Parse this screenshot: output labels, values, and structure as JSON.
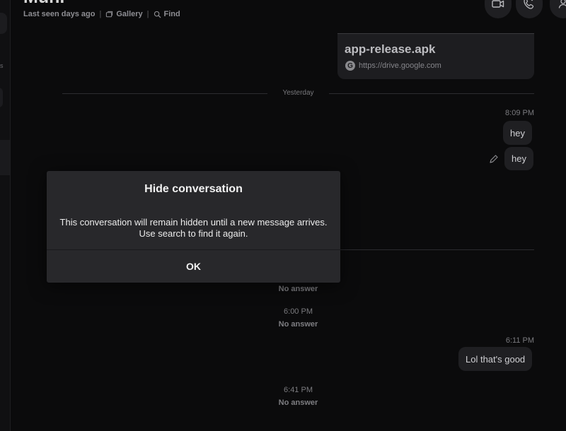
{
  "header": {
    "contact_name": "Muni",
    "status": "Last seen days ago",
    "gallery_label": "Gallery",
    "find_label": "Find"
  },
  "sidebar": {
    "fragment_text": "s"
  },
  "file_card": {
    "name": "app-release.apk",
    "url": "https://drive.google.com"
  },
  "day_separator": "Yesterday",
  "messages": [
    {
      "time": "8:09 PM",
      "text": "hey"
    },
    {
      "text": "hey"
    },
    {
      "status": "No answer"
    },
    {
      "time": "6:00 PM",
      "status": "No answer"
    },
    {
      "time": "6:11 PM",
      "text": "Lol that's good"
    },
    {
      "time": "6:41 PM",
      "status": "No answer"
    }
  ],
  "modal": {
    "title": "Hide conversation",
    "body": "This conversation will remain hidden until a new message arrives. Use search to find it again.",
    "ok_label": "OK"
  },
  "icons": {
    "video": "video-icon",
    "call": "phone-icon",
    "profile": "person-icon",
    "gallery": "gallery-icon",
    "find": "search-icon",
    "edit": "pencil-icon",
    "google": "google-icon"
  }
}
